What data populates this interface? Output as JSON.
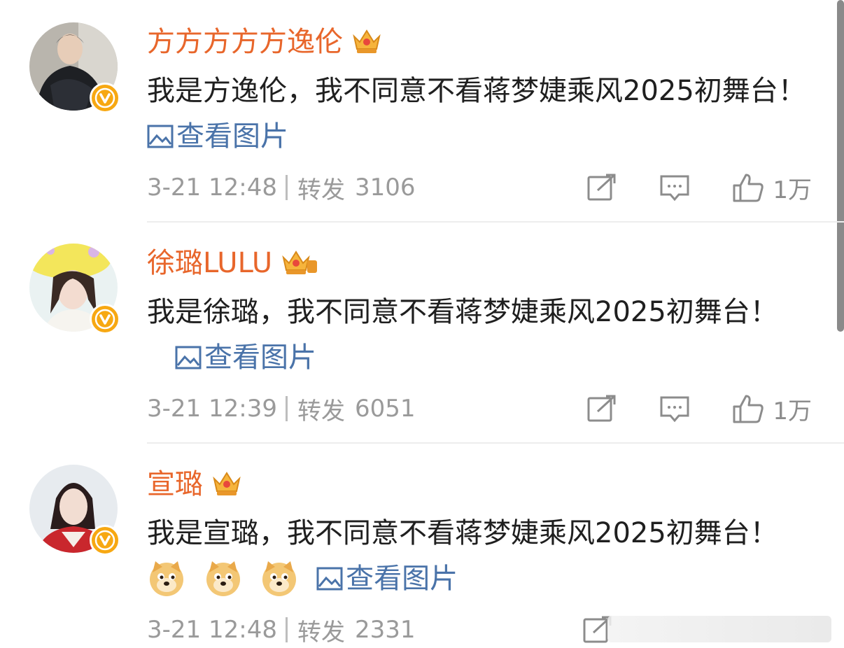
{
  "posts": [
    {
      "name": "方方方方方逸伦",
      "text": "我是方逸伦，我不同意不看蒋梦婕乘风2025初舞台！",
      "view_images": "查看图片",
      "time": "3-21 12:48",
      "repost_label": "转发",
      "repost_count": "3106",
      "like_count": "1万"
    },
    {
      "name": "徐璐LULU",
      "text": "我是徐璐，我不同意不看蒋梦婕乘风2025初舞台！",
      "view_images": "查看图片",
      "time": "3-21 12:39",
      "repost_label": "转发",
      "repost_count": "6051",
      "like_count": "1万"
    },
    {
      "name": "宣璐",
      "text": "我是宣璐，我不同意不看蒋梦婕乘风2025初舞台！",
      "view_images": "查看图片",
      "time": "3-21 12:48",
      "repost_label": "转发",
      "repost_count": "2331",
      "like_count": ""
    }
  ],
  "icons": {
    "verified": "verified-v-icon",
    "crown": "vip-crown-icon",
    "image": "image-icon",
    "repost": "repost-icon",
    "comment": "comment-icon",
    "like": "thumbs-up-icon",
    "emoji": "doge-emoji-icon"
  },
  "colors": {
    "name": "#e8662b",
    "link": "#4a73a9",
    "meta": "#9a9a9a",
    "verified": "#f7a812"
  }
}
